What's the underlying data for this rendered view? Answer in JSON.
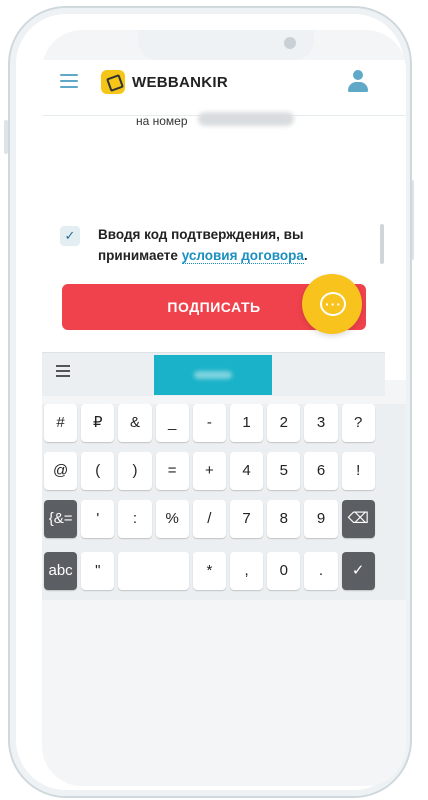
{
  "app": {
    "brand": "WEBBANKIR",
    "number_prefix": "на номер",
    "consent_text": "Вводя код подтверждения, вы принимаете",
    "consent_link": "условия договора",
    "consent_end": ".",
    "sign_button": "ПОДПИСАТЬ",
    "checkbox_mark": "✓",
    "chat_dots": "···"
  },
  "keyboard": {
    "rows": [
      [
        "#",
        "₽",
        "&",
        "_",
        "-",
        "1",
        "2",
        "3",
        "?"
      ],
      [
        "@",
        "(",
        ")",
        "=",
        "+",
        "4",
        "5",
        "6",
        "!"
      ],
      [
        "{&=",
        "'",
        ":",
        "%",
        "/",
        "7",
        "8",
        "9",
        "⌫"
      ],
      [
        "abc",
        "\"",
        "",
        "*",
        ",",
        "0",
        ".",
        "✓"
      ]
    ]
  },
  "colors": {
    "accent_blue": "#1a8fc2",
    "button_red": "#f0424c",
    "brand_yellow": "#f5c518",
    "key_dark": "#5b5f63"
  }
}
